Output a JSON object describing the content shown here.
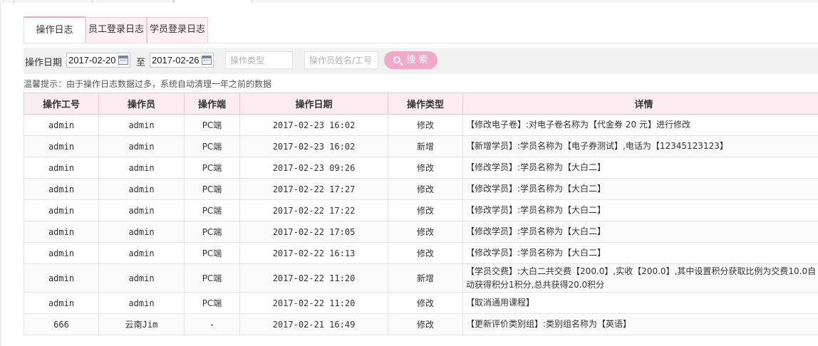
{
  "tabs": [
    {
      "label": "操作日志"
    },
    {
      "label": "员工登录日志"
    },
    {
      "label": "学员登录日志"
    }
  ],
  "search": {
    "date_label": "操作日期",
    "date_from": "2017-02-20",
    "to_label": "至",
    "date_to": "2017-02-26",
    "type_placeholder": "操作类型",
    "operator_placeholder": "操作员姓名/工号",
    "button_label": "搜 索"
  },
  "tip": "温馨提示：由于操作日志数据过多，系统自动清理一年之前的数据",
  "table": {
    "columns": [
      "操作工号",
      "操作员",
      "操作端",
      "操作日期",
      "操作类型",
      "详情"
    ],
    "rows": [
      {
        "id": "admin",
        "op": "admin",
        "client": "PC端",
        "date": "2017-02-23 16:02",
        "type": "修改",
        "detail": "【修改电子卷】:对电子卷名称为【代金券 20 元】进行修改"
      },
      {
        "id": "admin",
        "op": "admin",
        "client": "PC端",
        "date": "2017-02-23 16:02",
        "type": "新增",
        "detail": "【新增学员】:学员名称为【电子券测试】,电话为【12345123123】"
      },
      {
        "id": "admin",
        "op": "admin",
        "client": "PC端",
        "date": "2017-02-23 09:26",
        "type": "修改",
        "detail": "【修改学员】:学员名称为【大白二】"
      },
      {
        "id": "admin",
        "op": "admin",
        "client": "PC端",
        "date": "2017-02-22 17:27",
        "type": "修改",
        "detail": "【修改学员】:学员名称为【大白二】"
      },
      {
        "id": "admin",
        "op": "admin",
        "client": "PC端",
        "date": "2017-02-22 17:22",
        "type": "修改",
        "detail": "【修改学员】:学员名称为【大白二】"
      },
      {
        "id": "admin",
        "op": "admin",
        "client": "PC端",
        "date": "2017-02-22 17:05",
        "type": "修改",
        "detail": "【修改学员】:学员名称为【大白二】"
      },
      {
        "id": "admin",
        "op": "admin",
        "client": "PC端",
        "date": "2017-02-22 16:13",
        "type": "修改",
        "detail": "【修改学员】:学员名称为【大白二】"
      },
      {
        "id": "admin",
        "op": "admin",
        "client": "PC端",
        "date": "2017-02-22 11:20",
        "type": "新增",
        "detail": "【学员交费】:大白二共交费【200.0】,实收【200.0】,其中设置积分获取比例为交费10.0自动获得积分1积分,总共获得20.0积分"
      },
      {
        "id": "admin",
        "op": "admin",
        "client": "PC端",
        "date": "2017-02-22 11:20",
        "type": "修改",
        "detail": "【取消通用课程】"
      },
      {
        "id": "666",
        "op": "云南Jim",
        "client": "-",
        "date": "2017-02-21 16:49",
        "type": "修改",
        "detail": "【更新评价类别组】:类别组名称为【英语】"
      }
    ]
  }
}
